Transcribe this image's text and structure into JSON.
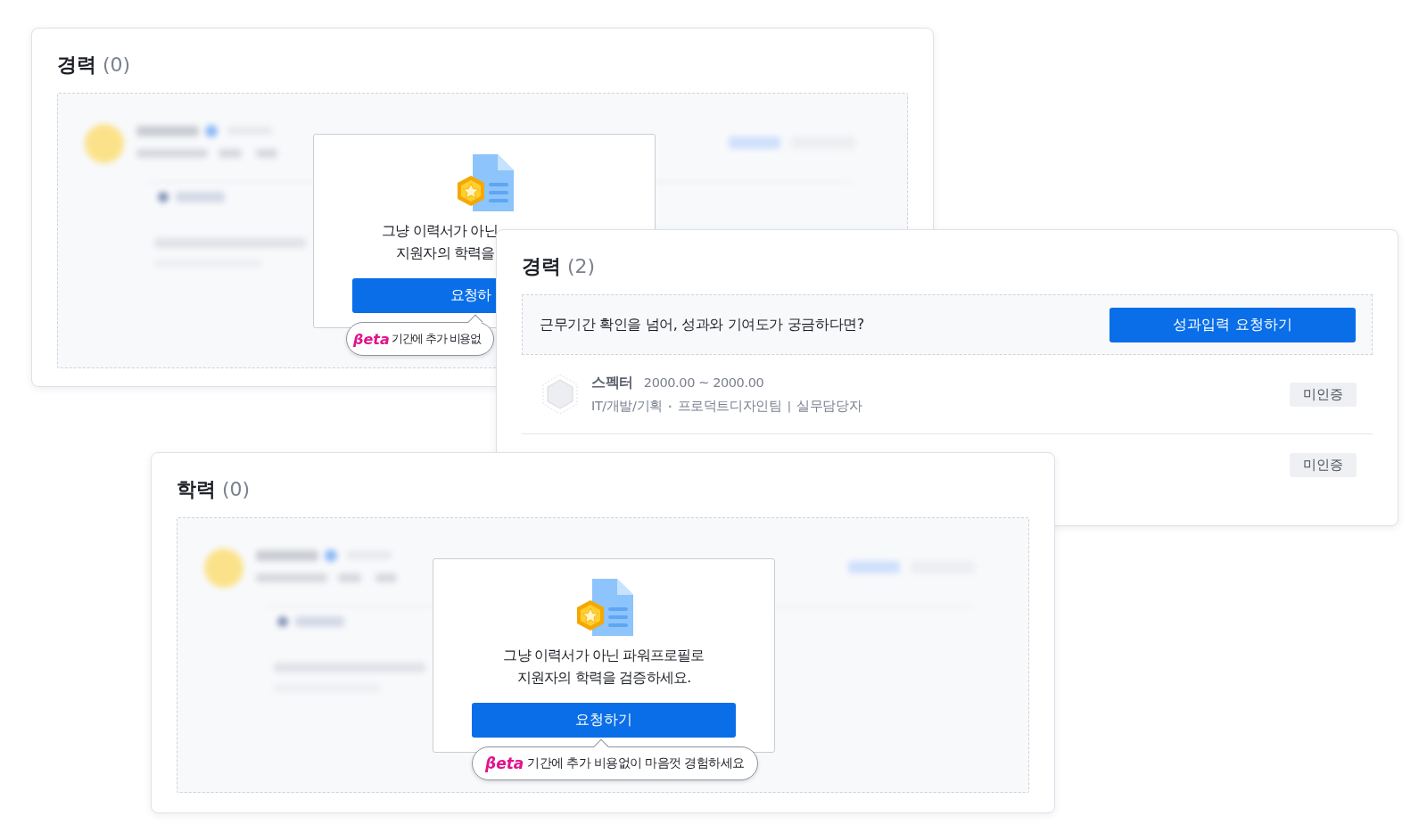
{
  "cards": [
    {
      "kind": "verify",
      "title": "경력",
      "count": "(0)",
      "promo": {
        "lines": [
          "그냥 이력서가 아닌",
          "지원자의 학력을"
        ],
        "button": "요청하",
        "beta_logo": "βeta",
        "beta_text": "기간에 추가 비용없"
      }
    },
    {
      "kind": "career",
      "title": "경력",
      "count": "(2)",
      "banner": {
        "text": "근무기간 확인을 넘어, 성과와 기여도가 궁금하다면?",
        "button": "성과입력 요청하기"
      },
      "rows": [
        {
          "company": "스펙터",
          "period": "2000.00 ~ 2000.00",
          "category": "IT/개발/기획",
          "sep1": "·",
          "team": "프로덕트디자인팀",
          "sep2": "|",
          "role": "실무담당자",
          "status": "미인증"
        },
        {
          "status": "미인증"
        }
      ]
    },
    {
      "kind": "verify",
      "title": "학력",
      "count": "(0)",
      "promo": {
        "lines": [
          "그냥 이력서가 아닌 파워프로필로",
          "지원자의 학력을 검증하세요."
        ],
        "button": "요청하기",
        "beta_logo": "βeta",
        "beta_text": "기간에 추가 비용없이 마음껏 경험하세요"
      }
    }
  ]
}
